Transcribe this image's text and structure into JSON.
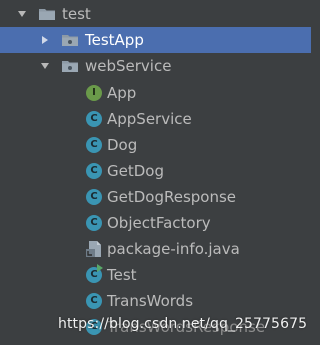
{
  "project_tree": {
    "root": {
      "label": "test",
      "expanded": true,
      "icon": "folder-icon"
    },
    "items": [
      {
        "label": "TestApp",
        "type": "package",
        "expanded": false,
        "selected": true
      },
      {
        "label": "webService",
        "type": "package",
        "expanded": true,
        "selected": false
      },
      {
        "label": "App",
        "type": "interface",
        "icon_letter": "I"
      },
      {
        "label": "AppService",
        "type": "class",
        "icon_letter": "C"
      },
      {
        "label": "Dog",
        "type": "class",
        "icon_letter": "C"
      },
      {
        "label": "GetDog",
        "type": "class",
        "icon_letter": "C"
      },
      {
        "label": "GetDogResponse",
        "type": "class",
        "icon_letter": "C"
      },
      {
        "label": "ObjectFactory",
        "type": "class",
        "icon_letter": "C"
      },
      {
        "label": "package-info.java",
        "type": "java-file"
      },
      {
        "label": "Test",
        "type": "runnable-class",
        "icon_letter": "C"
      },
      {
        "label": "TransWords",
        "type": "class",
        "icon_letter": "C"
      },
      {
        "label": "TransWordsResponse",
        "type": "class",
        "icon_letter": "C"
      }
    ]
  },
  "watermark": "https://blog.csdn.net/qq_25775675",
  "colors": {
    "background": "#3c3f41",
    "selection": "#4b6eaf",
    "text": "#bbbbbb",
    "class_icon": "#3a95b3",
    "interface_icon": "#6a9a4a"
  }
}
